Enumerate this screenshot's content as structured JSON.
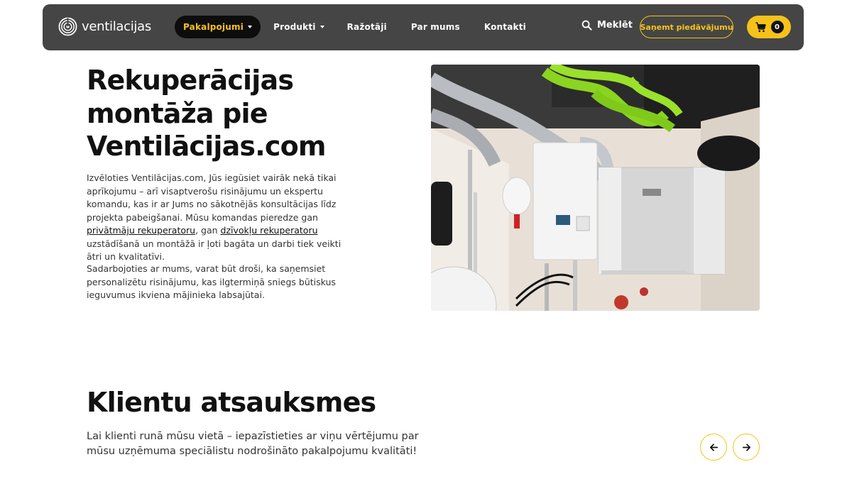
{
  "header": {
    "logo_text": "ventilacijas",
    "nav": [
      {
        "label": "Pakalpojumi",
        "has_dropdown": true,
        "active": true
      },
      {
        "label": "Produkti",
        "has_dropdown": true,
        "active": false
      },
      {
        "label": "Ražotāji",
        "has_dropdown": false,
        "active": false
      },
      {
        "label": "Par mums",
        "has_dropdown": false,
        "active": false
      },
      {
        "label": "Kontakti",
        "has_dropdown": false,
        "active": false
      }
    ],
    "search_label": "Meklēt",
    "cta_label": "Saņemt piedāvājumu",
    "cart_count": "0"
  },
  "hero": {
    "title": "Rekuperācijas montāža pie Ventilācijas.com",
    "p1_part1": "Izvēloties Ventilācijas.com, Jūs iegūsiet vairāk nekā tikai aprīkojumu – arī visaptverošu risinājumu un ekspertu komandu, kas ir ar Jums no sākotnējās konsultācijas līdz projekta pabeigšanai. Mūsu komandas pieredze gan ",
    "link1": "privātmāju rekuperatoru",
    "p1_part2": ", gan ",
    "link2": "dzīvokļu rekuperatoru",
    "p1_part3": " uzstādīšanā un montāžā ir ļoti bagāta un darbi tiek veikti ātri un kvalitatīvi.",
    "p2": "Sadarbojoties ar mums, varat būt droši, ka saņemsiet personalizētu risinājumu, kas ilgtermiņā sniegs būtiskus ieguvumus ikviena mājinieka labsajūtai."
  },
  "testimonials": {
    "title": "Klientu atsauksmes",
    "text": "Lai klienti runā mūsu vietā – iepazīstieties ar viņu vērtējumu par mūsu uzņēmuma speciālistu nodrošināto pakalpojumu kvalitāti!"
  },
  "colors": {
    "header_bg": "#454545",
    "accent": "#f5c21a",
    "active_nav_bg": "#0d0d0d"
  },
  "icons": {
    "logo": "spiral-logo-icon",
    "search": "search-icon",
    "cart": "shopping-cart-icon",
    "prev": "arrow-left-icon",
    "next": "arrow-right-icon"
  }
}
